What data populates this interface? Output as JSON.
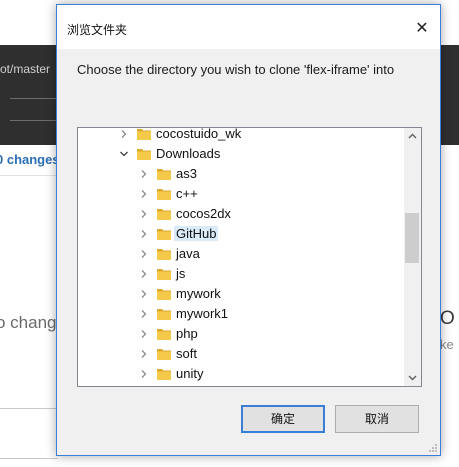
{
  "background": {
    "branch_text": "ot/master",
    "changes_link": "0 changes",
    "no_changes_text": "o change",
    "right_letter": "O",
    "right_text": "ke"
  },
  "dialog": {
    "title": "浏览文件夹",
    "close_glyph": "✕",
    "instruction": "Choose the directory you wish to clone 'flex-iframe' into",
    "ok_label": "确定",
    "cancel_label": "取消",
    "tree": [
      {
        "label": "cocostuido_wk",
        "level": 0,
        "expanded": false,
        "selected": false
      },
      {
        "label": "Downloads",
        "level": 0,
        "expanded": true,
        "selected": false
      },
      {
        "label": "as3",
        "level": 1,
        "expanded": false,
        "selected": false
      },
      {
        "label": "c++",
        "level": 1,
        "expanded": false,
        "selected": false
      },
      {
        "label": "cocos2dx",
        "level": 1,
        "expanded": false,
        "selected": false
      },
      {
        "label": "GitHub",
        "level": 1,
        "expanded": false,
        "selected": true
      },
      {
        "label": "java",
        "level": 1,
        "expanded": false,
        "selected": false
      },
      {
        "label": "js",
        "level": 1,
        "expanded": false,
        "selected": false
      },
      {
        "label": "mywork",
        "level": 1,
        "expanded": false,
        "selected": false
      },
      {
        "label": "mywork1",
        "level": 1,
        "expanded": false,
        "selected": false
      },
      {
        "label": "php",
        "level": 1,
        "expanded": false,
        "selected": false
      },
      {
        "label": "soft",
        "level": 1,
        "expanded": false,
        "selected": false
      },
      {
        "label": "unity",
        "level": 1,
        "expanded": false,
        "selected": false
      }
    ]
  },
  "colors": {
    "accent": "#3a7fd5",
    "folder": "#f5c949",
    "selection": "#d9ebf9"
  }
}
